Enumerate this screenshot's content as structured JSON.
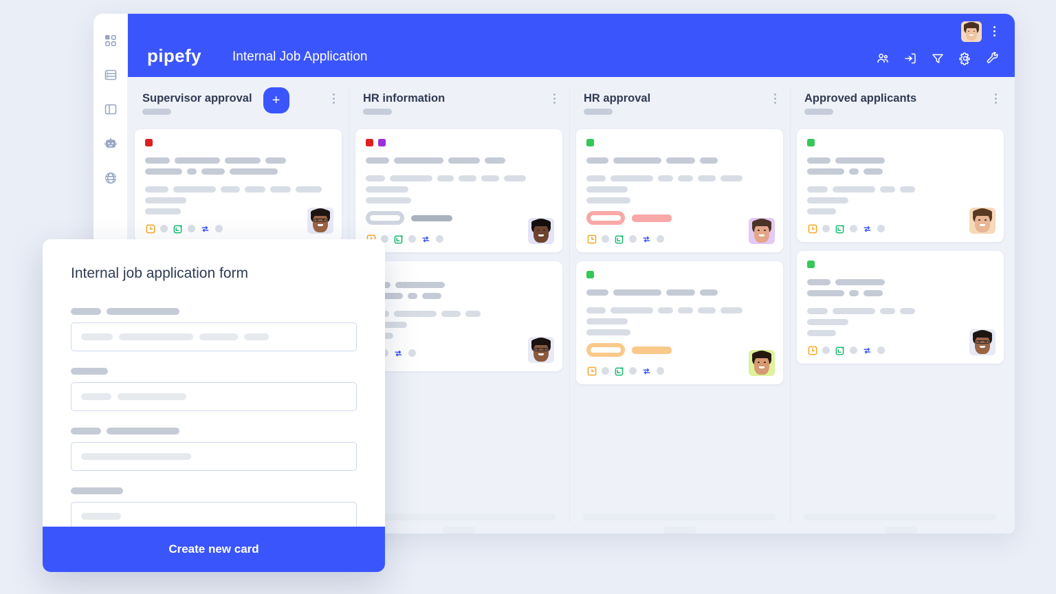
{
  "app": {
    "logo_text": "pipefy",
    "board_title": "Internal Job Application",
    "header_color": "#3b55fd",
    "page_background": "#eaeef7"
  },
  "sidebar": {
    "items": [
      {
        "icon": "apps-grid-icon",
        "label": "Apps"
      },
      {
        "icon": "database-icon",
        "label": "Database"
      },
      {
        "icon": "layout-panel-icon",
        "label": "Layout"
      },
      {
        "icon": "robot-icon",
        "label": "Automations"
      },
      {
        "icon": "globe-icon",
        "label": "Portal"
      }
    ]
  },
  "header_actions": [
    {
      "icon": "members-icon",
      "label": "Members"
    },
    {
      "icon": "import-export-icon",
      "label": "Import"
    },
    {
      "icon": "filter-icon",
      "label": "Filter"
    },
    {
      "icon": "gear-icon",
      "label": "Settings"
    },
    {
      "icon": "wrench-icon",
      "label": "Tools"
    }
  ],
  "board": {
    "add_card_button_label": "+",
    "columns": [
      {
        "title": "Supervisor approval",
        "has_add_button": true,
        "cards": [
          {
            "chips": [
              "#e02020"
            ],
            "pill_style": "none",
            "avatar": {
              "skin": "#9a6445",
              "hair": "#1d1512",
              "bg": "#e8e9f6",
              "glasses": true
            },
            "footer_icons": [
              "clock-icon",
              "calendar-plus-icon",
              "connection-icon"
            ]
          }
        ]
      },
      {
        "title": "HR information",
        "has_add_button": false,
        "cards": [
          {
            "chips": [
              "#e02020",
              "#9b30d9"
            ],
            "pill_style": "grey",
            "pill_color": "#cfd5e0",
            "avatar": {
              "skin": "#6e4430",
              "hair": "#140f0c",
              "bg": "#e4e4f7",
              "glasses": false
            },
            "footer_icons": [
              "clock-icon",
              "calendar-plus-icon",
              "connection-icon"
            ]
          },
          {
            "chips": [],
            "pill_style": "none",
            "avatar": {
              "skin": "#8a5a3e",
              "hair": "#191210",
              "bg": "#e8e9f6",
              "glasses": true
            },
            "footer_icons": [
              "calendar-plus-icon",
              "connection-icon"
            ]
          }
        ]
      },
      {
        "title": "HR approval",
        "has_add_button": false,
        "cards": [
          {
            "chips": [
              "#34c759"
            ],
            "pill_style": "pink",
            "pill_color": "#f9a8a8",
            "avatar": {
              "skin": "#e3a688",
              "hair": "#4a3326",
              "bg": "#e3c9f5",
              "glasses": false
            },
            "footer_icons": [
              "clock-icon",
              "calendar-plus-icon",
              "connection-icon"
            ]
          },
          {
            "chips": [
              "#34c759"
            ],
            "pill_style": "orange",
            "pill_color": "#fac98a",
            "avatar": {
              "skin": "#d69a72",
              "hair": "#24180f",
              "bg": "#ddf29b",
              "glasses": false
            },
            "footer_icons": [
              "clock-icon",
              "calendar-plus-icon",
              "connection-icon"
            ]
          }
        ]
      },
      {
        "title": "Approved applicants",
        "has_add_button": false,
        "cards": [
          {
            "chips": [
              "#34c759"
            ],
            "pill_style": "none",
            "avatar": {
              "skin": "#e8b694",
              "hair": "#5a3a22",
              "bg": "#f6d9b9",
              "glasses": false
            },
            "footer_icons": [
              "clock-icon",
              "calendar-plus-icon",
              "connection-icon"
            ]
          },
          {
            "chips": [
              "#34c759"
            ],
            "pill_style": "none",
            "avatar": {
              "skin": "#9a6445",
              "hair": "#1d1512",
              "bg": "#e8e9f6",
              "glasses": true
            },
            "footer_icons": [
              "clock-icon",
              "calendar-plus-icon",
              "connection-icon"
            ]
          }
        ]
      }
    ]
  },
  "modal": {
    "title": "Internal job application form",
    "submit_label": "Create new card",
    "fields": [
      {
        "label_widths": [
          44,
          106
        ],
        "input_widths": [
          46,
          108,
          56,
          36
        ]
      },
      {
        "label_widths": [
          54
        ],
        "input_widths": [
          44,
          100
        ]
      },
      {
        "label_widths": [
          44,
          106
        ],
        "input_widths": [
          160
        ]
      },
      {
        "label_widths": [
          76
        ],
        "input_widths": [
          58
        ]
      }
    ]
  },
  "card_skeleton": {
    "row1": [
      36,
      66,
      52,
      30
    ],
    "row2": [
      54,
      14,
      34,
      70
    ],
    "row3": [
      34,
      62,
      28,
      30,
      30,
      38
    ],
    "row4": [
      60
    ],
    "row5": [
      52
    ]
  },
  "colors": {
    "accent": "#3b55fd",
    "clock_icon": "#f5a623",
    "calendar_icon": "#16b870",
    "connection_icon": "#3b55fd",
    "skeleton_dark": "#c5cbd6",
    "skeleton_light": "#d8dde5",
    "board_bg": "#eef1f8"
  }
}
